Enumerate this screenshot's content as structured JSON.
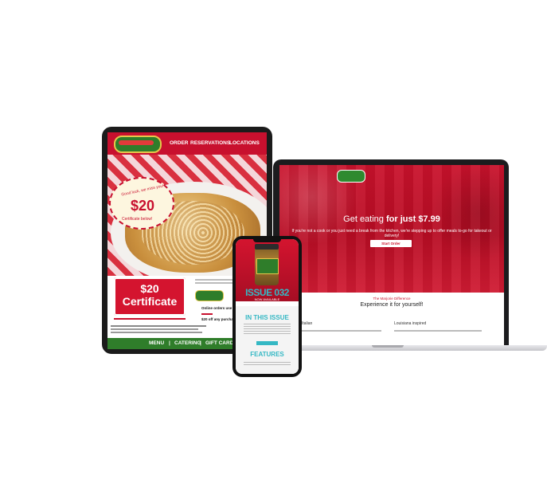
{
  "laptop": {
    "hero_title_prefix": "Get eating",
    "hero_title_bold": "for just $7.99",
    "hero_subtitle": "If you're not a cook or you just need a break from the kitchen, we're stepping up to offer meals to-go for takeout or delivery!",
    "cta_label": "Start Order",
    "difference_label": "The Marjorie Difference",
    "experience_title": "Experience it for yourself!",
    "col_left_title": "Italian",
    "col_right_title": "Louisiana inspired"
  },
  "tablet": {
    "nav": [
      "ORDER",
      "RESERVATIONS",
      "LOCATIONS"
    ],
    "badge_text": "Good luck, we miss you!",
    "badge_amount": "$20",
    "badge_caption": "Certificate below!",
    "certificate_amount": "$20",
    "certificate_label": "Certificate",
    "bullet_1": "Online orders use c",
    "bullet_2": "$20 off any purcha",
    "footer": [
      "MENU",
      "|",
      "CATERING",
      "|",
      "GIFT CARD"
    ]
  },
  "phone": {
    "issue_title": "ISSUE 032",
    "issue_sub": "NOW AVAILABLE",
    "section_1": "IN THIS ISSUE",
    "section_2": "FEATURES"
  },
  "colors": {
    "brand_red": "#c8102e",
    "brand_green": "#2f7d2a",
    "accent_teal": "#35b8c4"
  }
}
